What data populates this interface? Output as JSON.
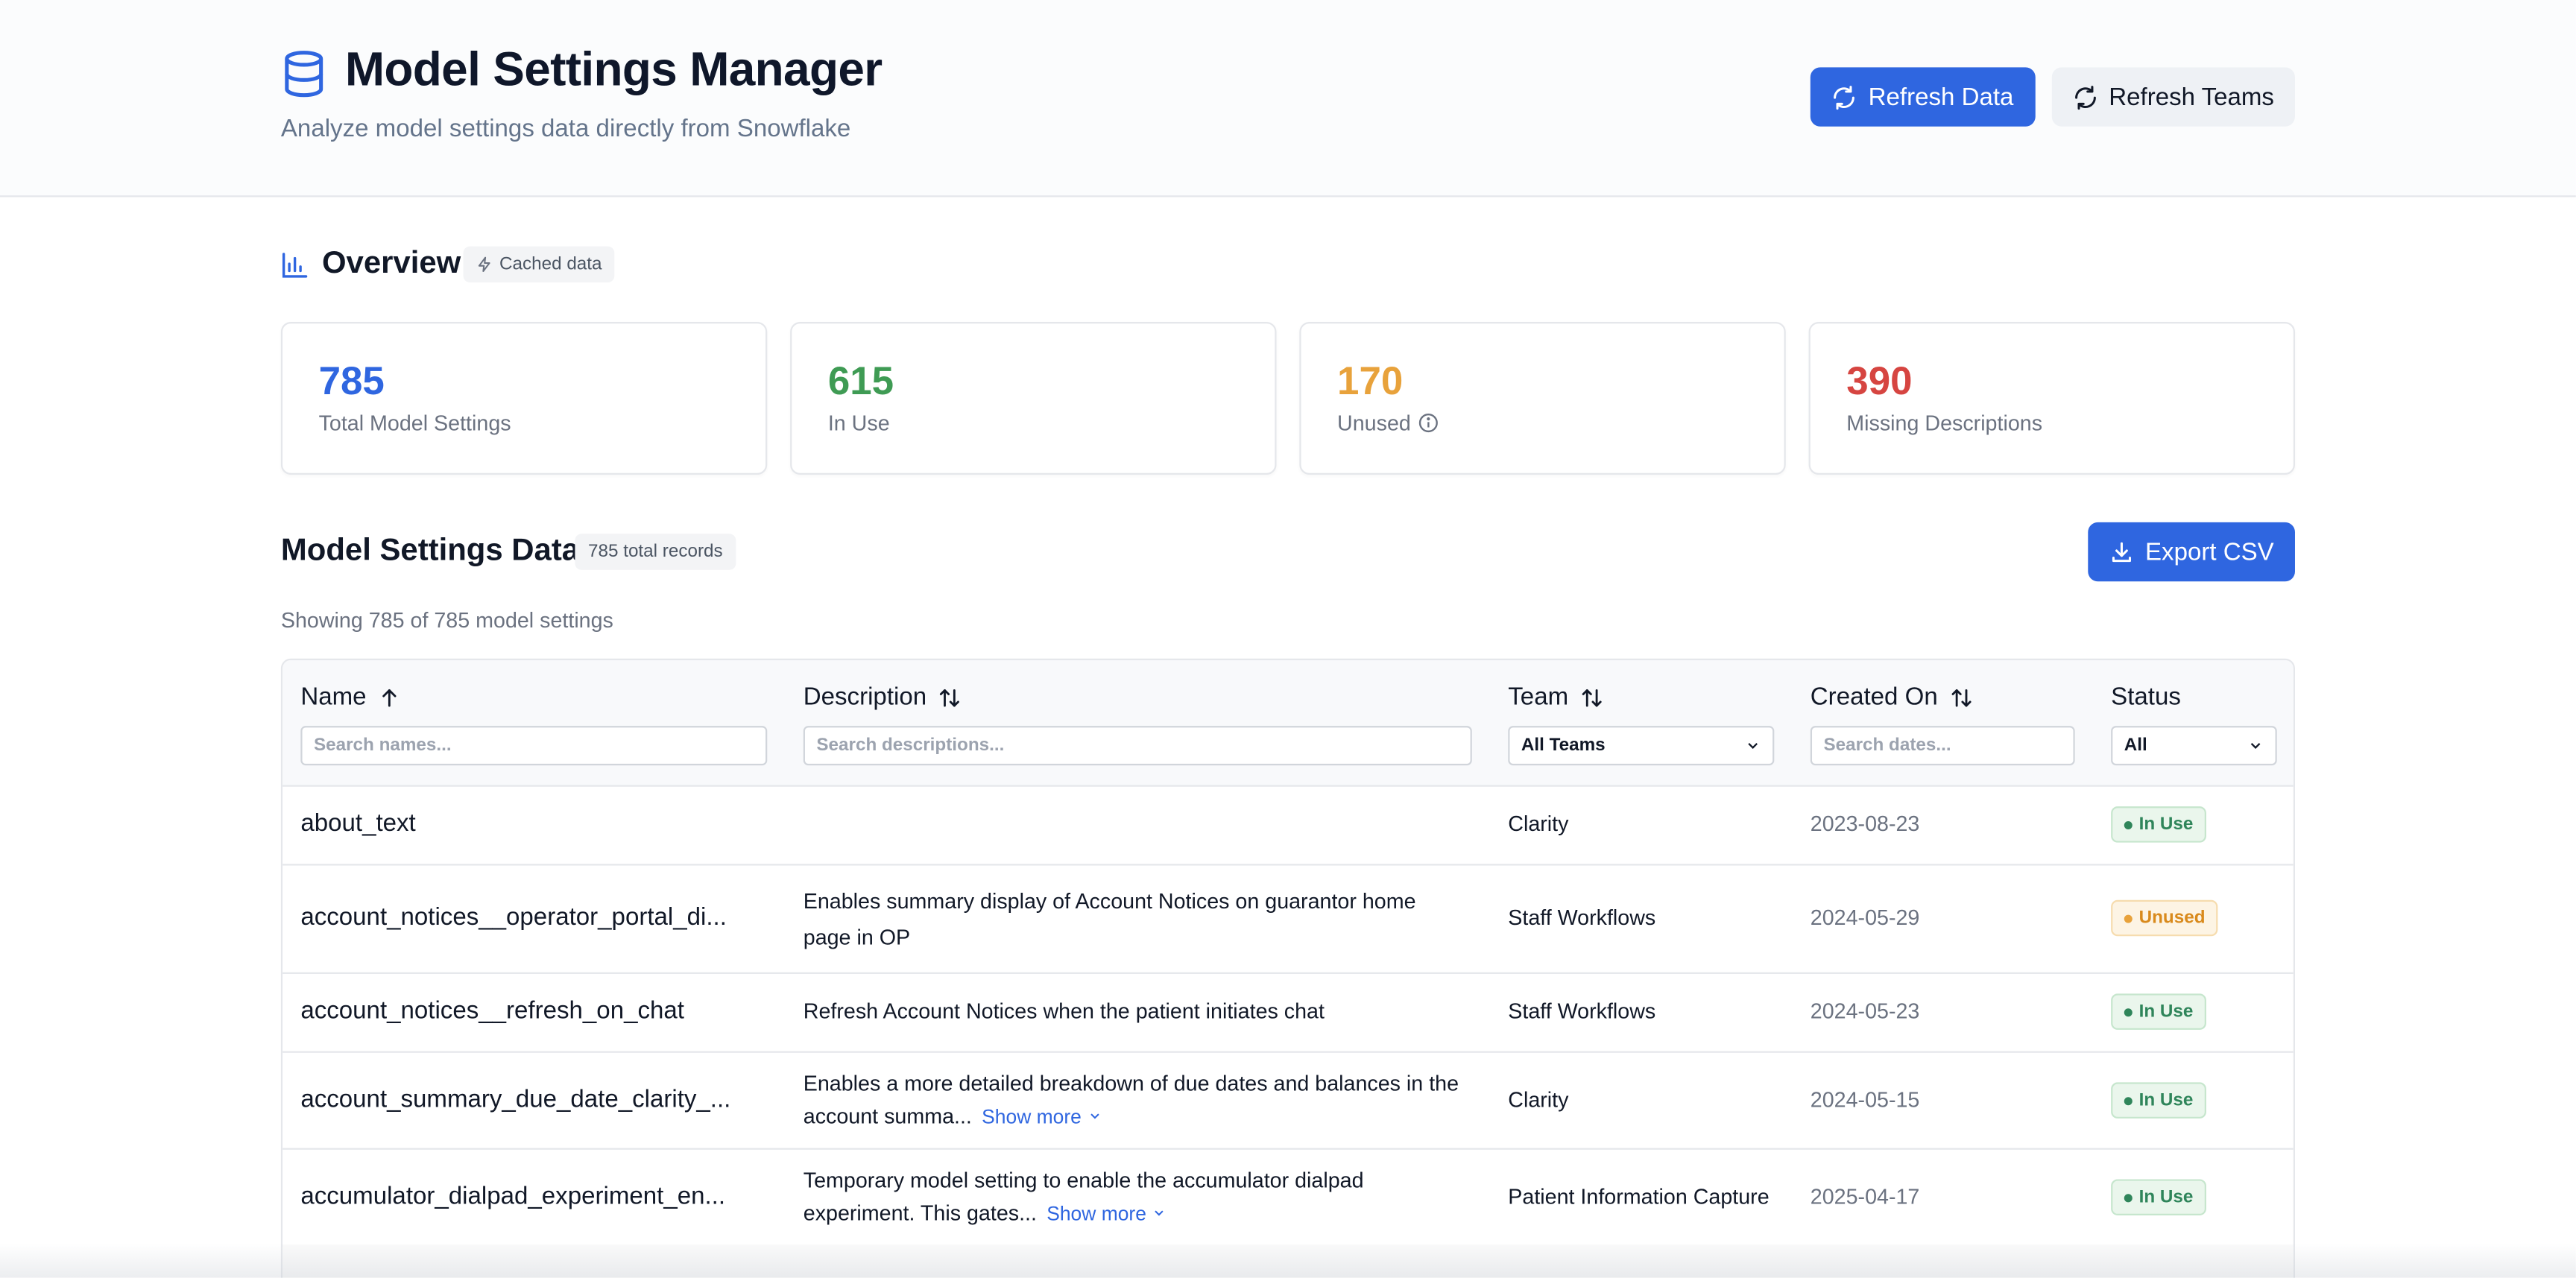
{
  "header": {
    "title": "Model Settings Manager",
    "subtitle": "Analyze model settings data directly from Snowflake",
    "refresh_data_label": "Refresh Data",
    "refresh_teams_label": "Refresh Teams"
  },
  "overview": {
    "title": "Overview",
    "cache_badge": "Cached data",
    "stats": [
      {
        "value": "785",
        "label": "Total Model Settings",
        "color": "#2f66e0"
      },
      {
        "value": "615",
        "label": "In Use",
        "color": "#3f9b54"
      },
      {
        "value": "170",
        "label": "Unused",
        "color": "#e8a23b"
      },
      {
        "value": "390",
        "label": "Missing Descriptions",
        "color": "#d64541"
      }
    ]
  },
  "data_section": {
    "title": "Model Settings Data",
    "records_badge": "785 total records",
    "export_label": "Export CSV",
    "showing_text": "Showing 785 of 785 model settings"
  },
  "table": {
    "columns": {
      "name": "Name",
      "description": "Description",
      "team": "Team",
      "created_on": "Created On",
      "status": "Status"
    },
    "filters": {
      "name_placeholder": "Search names...",
      "description_placeholder": "Search descriptions...",
      "team_value": "All Teams",
      "date_placeholder": "Search dates...",
      "status_value": "All"
    },
    "show_more_label": "Show more",
    "rows": [
      {
        "name": "about_text",
        "description": "",
        "team": "Clarity",
        "created_on": "2023-08-23",
        "status": "In Use"
      },
      {
        "name": "account_notices__operator_portal_di...",
        "description": "Enables summary display of Account Notices on guarantor home page in OP",
        "team": "Staff Workflows",
        "created_on": "2024-05-29",
        "status": "Unused"
      },
      {
        "name": "account_notices__refresh_on_chat",
        "description": "Refresh Account Notices when the patient initiates chat",
        "team": "Staff Workflows",
        "created_on": "2024-05-23",
        "status": "In Use"
      },
      {
        "name": "account_summary_due_date_clarity_...",
        "description": "Enables a more detailed breakdown of due dates and balances in the account summa...",
        "team": "Clarity",
        "created_on": "2024-05-15",
        "status": "In Use"
      },
      {
        "name": "accumulator_dialpad_experiment_en...",
        "description": "Temporary model setting to enable the accumulator dialpad experiment. This gates...",
        "team": "Patient Information Capture",
        "created_on": "2025-04-17",
        "status": "In Use"
      }
    ]
  }
}
